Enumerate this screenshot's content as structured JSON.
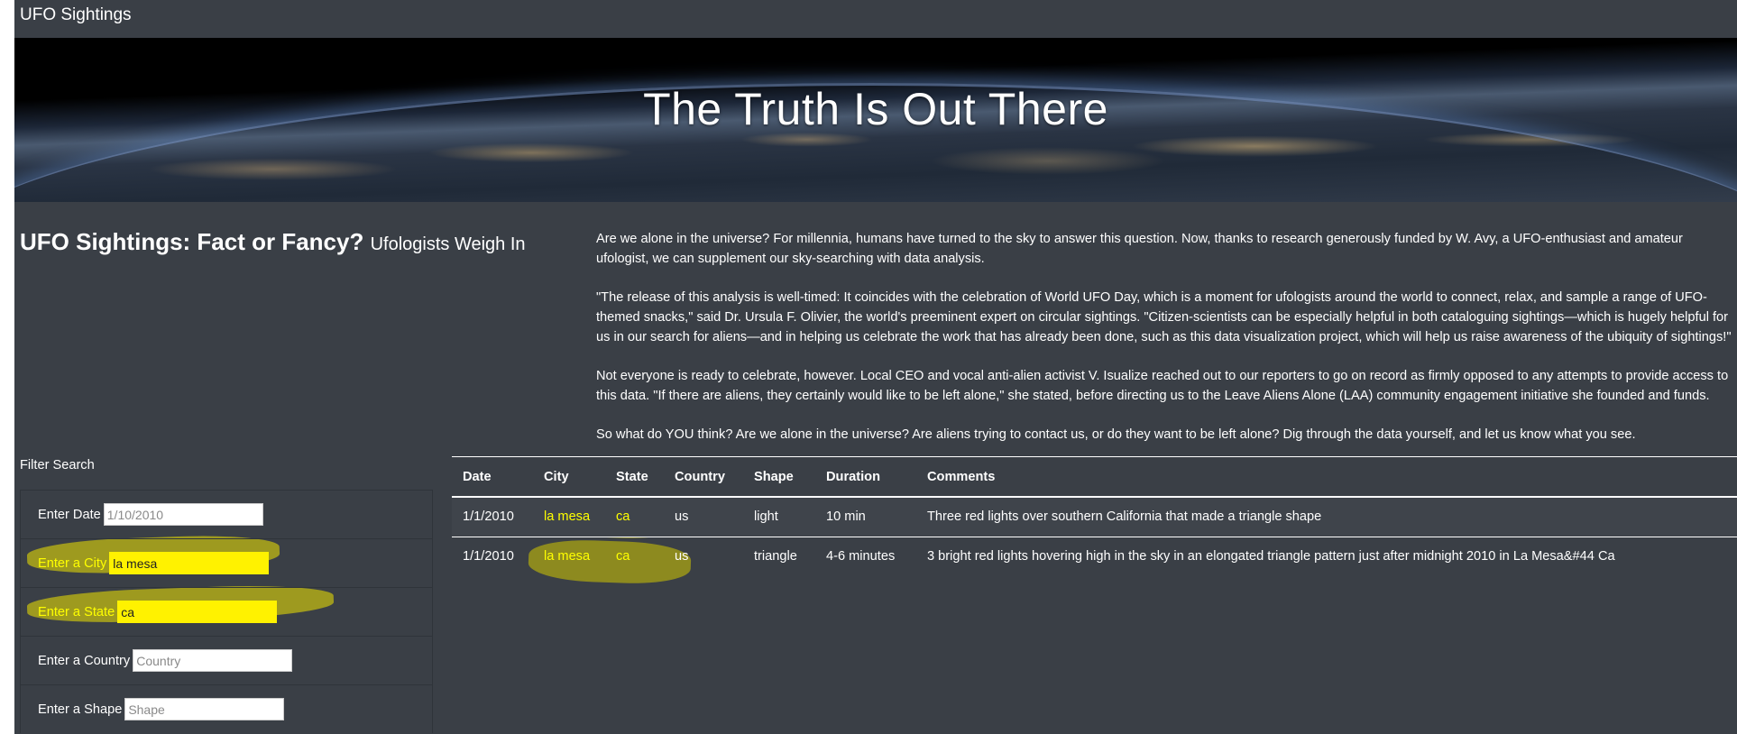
{
  "navbar": {
    "brand": "UFO Sightings"
  },
  "hero": {
    "title": "The Truth Is Out There"
  },
  "article": {
    "heading": "UFO Sightings: Fact or Fancy?",
    "subheading": "Ufologists Weigh In",
    "paragraphs": [
      "Are we alone in the universe? For millennia, humans have turned to the sky to answer this question. Now, thanks to research generously funded by W. Avy, a UFO-enthusiast and amateur ufologist, we can supplement our sky-searching with data analysis.",
      "\"The release of this analysis is well-timed: It coincides with the celebration of World UFO Day, which is a moment for ufologists around the world to connect, relax, and sample a range of UFO-themed snacks,\" said Dr. Ursula F. Olivier, the world's preeminent expert on circular sightings. \"Citizen-scientists can be especially helpful in both cataloguing sightings—which is hugely helpful for us in our search for aliens—and in helping us celebrate the work that has already been done, such as this data visualization project, which will help us raise awareness of the ubiquity of sightings!\"",
      "Not everyone is ready to celebrate, however. Local CEO and vocal anti-alien activist V. Isualize reached out to our reporters to go on record as firmly opposed to any attempts to provide access to this data. \"If there are aliens, they certainly would like to be left alone,\" she stated, before directing us to the Leave Aliens Alone (LAA) community engagement initiative she founded and funds.",
      "So what do YOU think? Are we alone in the universe? Are aliens trying to contact us, or do they want to be left alone? Dig through the data yourself, and let us know what you see."
    ]
  },
  "filters": {
    "title": "Filter Search",
    "date": {
      "label": "Enter Date",
      "value": "",
      "placeholder": "1/10/2010"
    },
    "city": {
      "label": "Enter a City",
      "value": "la mesa",
      "placeholder": ""
    },
    "state": {
      "label": "Enter a State",
      "value": "ca",
      "placeholder": ""
    },
    "country": {
      "label": "Enter a Country",
      "value": "",
      "placeholder": "Country"
    },
    "shape": {
      "label": "Enter a Shape",
      "value": "",
      "placeholder": "Shape"
    }
  },
  "table": {
    "headers": [
      "Date",
      "City",
      "State",
      "Country",
      "Shape",
      "Duration",
      "Comments"
    ],
    "rows": [
      [
        "1/1/2010",
        "la mesa",
        "ca",
        "us",
        "light",
        "10 min",
        "Three red lights over southern California that made a triangle shape"
      ],
      [
        "1/1/2010",
        "la mesa",
        "ca",
        "us",
        "triangle",
        "4-6 minutes",
        "3 bright red lights hovering high in the sky in an elongated triangle pattern just after midnight 2010 in La Mesa&#44 Ca"
      ]
    ]
  },
  "colors": {
    "background": "#3a3f46",
    "highlight": "#ffff00"
  }
}
